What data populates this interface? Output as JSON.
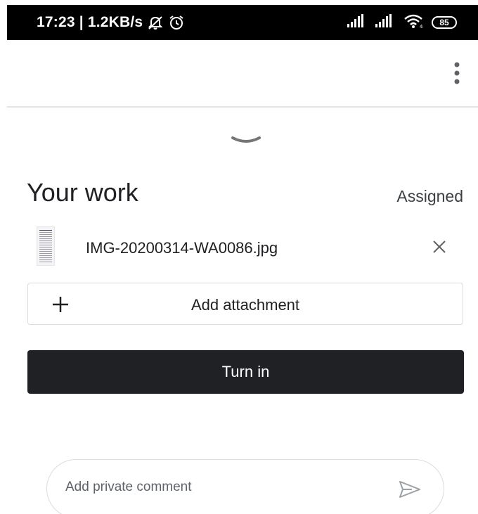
{
  "status_bar": {
    "time_speed": "17:23 | 1.2KB/s",
    "battery": "85",
    "icons": [
      "mute-icon",
      "alarm-icon",
      "signal-icon",
      "signal-icon",
      "wifi-icon",
      "battery-icon"
    ]
  },
  "app_bar": {
    "menu_icon": "more-vert-icon"
  },
  "your_work": {
    "title": "Your work",
    "status": "Assigned",
    "attachment": {
      "file_name": "IMG-20200314-WA0086.jpg",
      "remove_icon": "close-icon"
    },
    "add_attachment_label": "Add attachment",
    "turn_in_label": "Turn in"
  },
  "comment": {
    "placeholder": "Add private comment",
    "send_icon": "send-icon"
  },
  "colors": {
    "status_bar_bg": "#000000",
    "turn_in_bg": "#202124",
    "border": "#dadce0",
    "text_primary": "#202124",
    "icon_grey": "#5f6368"
  }
}
